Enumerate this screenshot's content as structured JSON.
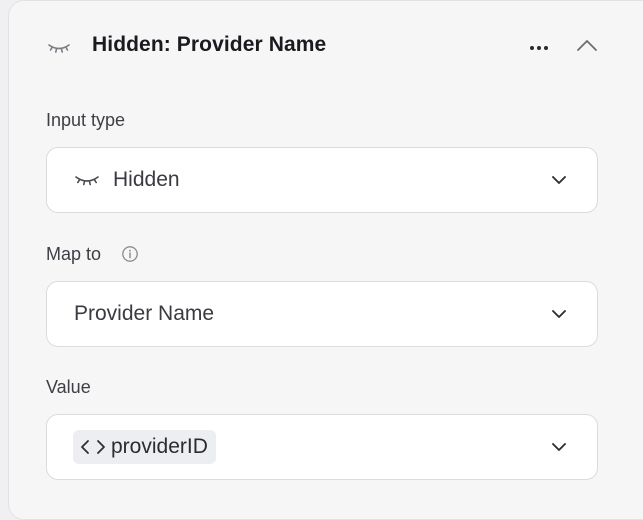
{
  "header": {
    "title": "Hidden: Provider Name",
    "icon": "eye-closed-icon",
    "more_icon": "more-horizontal-icon",
    "collapse_icon": "chevron-up-icon"
  },
  "fields": {
    "input_type": {
      "label": "Input type",
      "value": "Hidden",
      "icon": "eye-closed-icon"
    },
    "map_to": {
      "label": "Map to",
      "info_icon": "info-icon",
      "value": "Provider Name"
    },
    "value": {
      "label": "Value",
      "chip_icon": "code-brackets-icon",
      "chip_text": "providerID"
    }
  },
  "colors": {
    "panel_bg": "#f6f6f7",
    "page_bg": "#f0f0f2",
    "select_bg": "#ffffff",
    "chip_bg": "#eceef1",
    "text_primary": "#1b1b1f",
    "text_secondary": "#3e3e44"
  }
}
